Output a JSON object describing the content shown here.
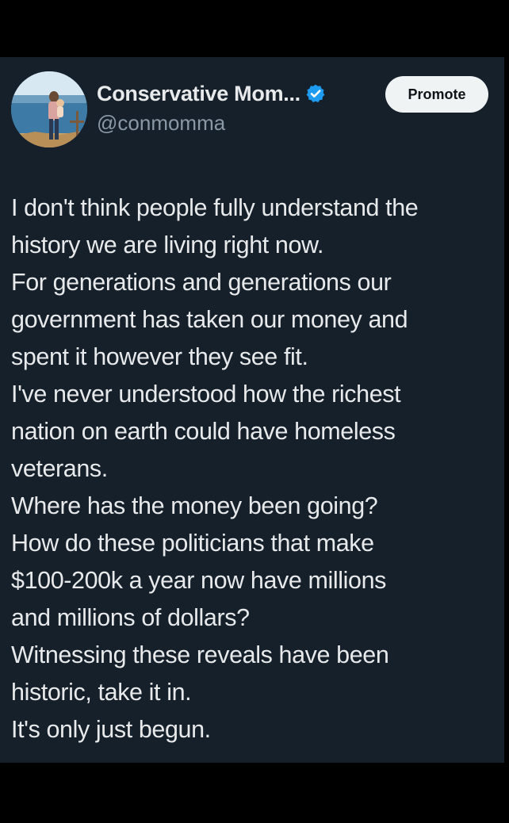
{
  "tweet": {
    "author": {
      "display_name": "Conservative Mom...",
      "handle": "@conmomma",
      "verified_icon": "verified-badge-icon"
    },
    "promote_label": "Promote",
    "lines": [
      "I don't think people fully understand the",
      "history we are living right now.",
      "For generations and generations our",
      "government has taken our money and",
      "spent it however they see fit.",
      "I've never understood how the richest",
      "nation on earth could have homeless",
      "veterans.",
      "Where has the money been going?",
      "How do these politicians that make",
      "$100-200k a year now have millions",
      "and millions of dollars?",
      "Witnessing these reveals have been",
      "historic, take it in.",
      "It's only just begun."
    ]
  },
  "colors": {
    "background": "#15202b",
    "text": "#e7e9ea",
    "secondary_text": "#8b98a5",
    "verified": "#1d9bf0",
    "button_bg": "#eff3f4",
    "button_text": "#0f1419"
  }
}
